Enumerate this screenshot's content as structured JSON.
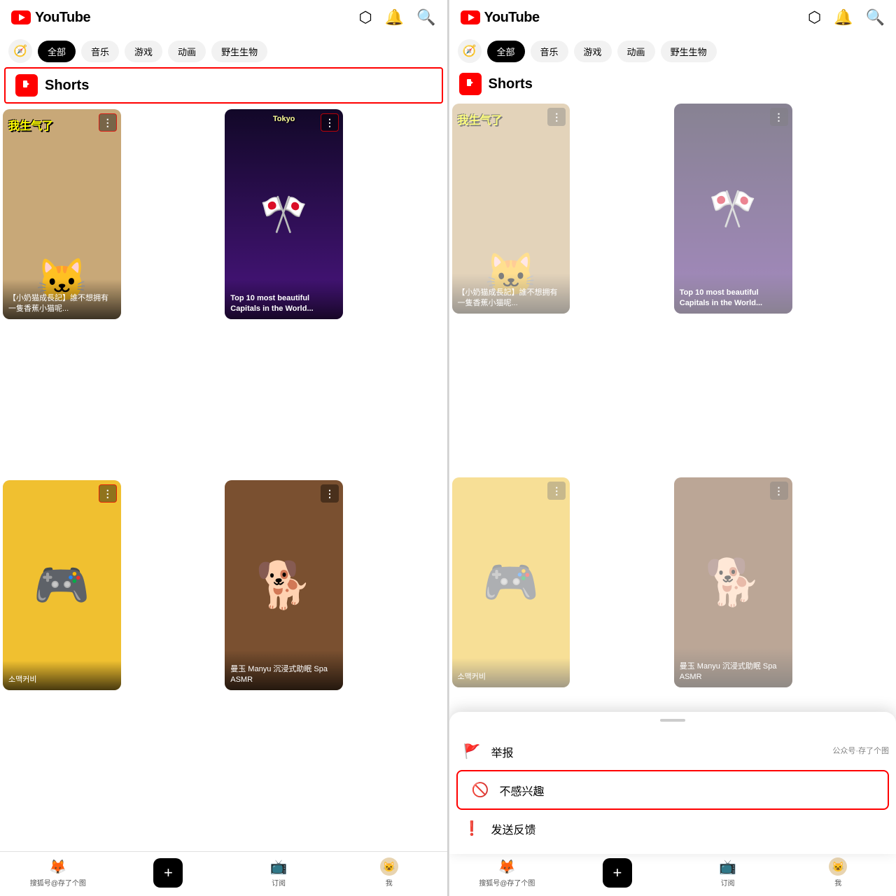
{
  "left_panel": {
    "header": {
      "logo_text": "YouTube",
      "icons": [
        "cast",
        "bell",
        "search"
      ]
    },
    "filter_tabs": [
      "全部",
      "音乐",
      "游戏",
      "动画",
      "野生生物"
    ],
    "active_tab": "全部",
    "shorts_label": "Shorts",
    "shorts_highlighted": true,
    "videos": [
      {
        "id": "cat",
        "title": "【小奶猫成長記】誰不想拥有一隻香蕉小猫呢...",
        "chinese_label": "我生气了",
        "has_more": true,
        "more_highlighted": true
      },
      {
        "id": "anime",
        "title": "Top 10 most beautiful Capitals in the World...",
        "has_more": true,
        "more_highlighted": true
      },
      {
        "id": "kirby",
        "title": "소맥커비",
        "has_more": true,
        "more_highlighted": true
      },
      {
        "id": "dog",
        "title": "曼玉 Manyu 沉浸式助眠 Spa ASMR",
        "has_more": true,
        "more_highlighted": true
      }
    ],
    "bottom_nav": [
      {
        "label": "搜狐号@存了个图",
        "icon": "search-brand"
      },
      {
        "label": "",
        "icon": "add"
      },
      {
        "label": "订阅",
        "icon": "subscriptions"
      },
      {
        "label": "我",
        "icon": "avatar"
      }
    ]
  },
  "right_panel": {
    "header": {
      "logo_text": "YouTube"
    },
    "filter_tabs": [
      "全部",
      "音乐",
      "游戏",
      "动画",
      "野生生物"
    ],
    "active_tab": "全部",
    "shorts_label": "Shorts",
    "bottom_sheet": {
      "items": [
        {
          "icon": "flag",
          "text": "举报"
        },
        {
          "icon": "ban",
          "text": "不感兴趣",
          "highlighted": true
        },
        {
          "icon": "feedback",
          "text": "发送反馈"
        }
      ]
    },
    "watermark": "公众号·存了个图"
  }
}
